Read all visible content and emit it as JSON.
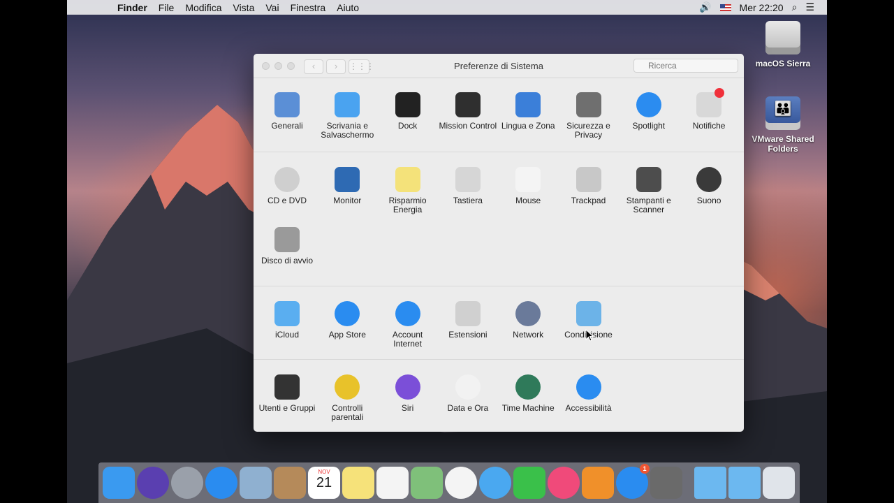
{
  "menubar": {
    "apple": "",
    "items": [
      "Finder",
      "File",
      "Modifica",
      "Vista",
      "Vai",
      "Finestra",
      "Aiuto"
    ],
    "clock": "Mer 22:20"
  },
  "desktop": {
    "icons": [
      {
        "label": "macOS Sierra"
      },
      {
        "label": "VMware Shared Folders"
      }
    ]
  },
  "window": {
    "title": "Preferenze di Sistema",
    "search_placeholder": "Ricerca",
    "sections": [
      [
        {
          "label": "Generali",
          "icon": "general-icon",
          "color": "#5b8fd6"
        },
        {
          "label": "Scrivania e Salvaschermo",
          "icon": "desktop-screensaver-icon",
          "color": "#4aa3f0"
        },
        {
          "label": "Dock",
          "icon": "dock-icon",
          "color": "#222222"
        },
        {
          "label": "Mission Control",
          "icon": "mission-control-icon",
          "color": "#2f2f2f"
        },
        {
          "label": "Lingua e Zona",
          "icon": "language-region-icon",
          "color": "#3b7fd9"
        },
        {
          "label": "Sicurezza e Privacy",
          "icon": "security-icon",
          "color": "#6f6f6f"
        },
        {
          "label": "Spotlight",
          "icon": "spotlight-icon",
          "color": "#2b8cf0"
        },
        {
          "label": "Notifiche",
          "icon": "notifications-icon",
          "color": "#d8d8d8"
        }
      ],
      [
        {
          "label": "CD e DVD",
          "icon": "cd-dvd-icon",
          "color": "#cfcfcf"
        },
        {
          "label": "Monitor",
          "icon": "monitor-icon",
          "color": "#2e6ab3"
        },
        {
          "label": "Risparmio Energia",
          "icon": "energy-icon",
          "color": "#f4e27a"
        },
        {
          "label": "Tastiera",
          "icon": "keyboard-icon",
          "color": "#d6d6d6"
        },
        {
          "label": "Mouse",
          "icon": "mouse-icon",
          "color": "#f4f4f4"
        },
        {
          "label": "Trackpad",
          "icon": "trackpad-icon",
          "color": "#c8c8c8"
        },
        {
          "label": "Stampanti e Scanner",
          "icon": "printer-icon",
          "color": "#4d4d4d"
        },
        {
          "label": "Suono",
          "icon": "sound-icon",
          "color": "#3a3a3a"
        },
        {
          "label": "Disco di avvio",
          "icon": "startup-disk-icon",
          "color": "#9a9a9a"
        }
      ],
      [
        {
          "label": "iCloud",
          "icon": "icloud-icon",
          "color": "#5aaef0"
        },
        {
          "label": "App Store",
          "icon": "app-store-icon",
          "color": "#2a8cf0"
        },
        {
          "label": "Account Internet",
          "icon": "internet-accounts-icon",
          "color": "#2a8cf0"
        },
        {
          "label": "Estensioni",
          "icon": "extensions-icon",
          "color": "#d0d0d0"
        },
        {
          "label": "Network",
          "icon": "network-icon",
          "color": "#6a7a9a"
        },
        {
          "label": "Condivisione",
          "icon": "sharing-icon",
          "color": "#6cb3e8"
        }
      ],
      [
        {
          "label": "Utenti e Gruppi",
          "icon": "users-groups-icon",
          "color": "#333333"
        },
        {
          "label": "Controlli parentali",
          "icon": "parental-controls-icon",
          "color": "#e8c22a"
        },
        {
          "label": "Siri",
          "icon": "siri-icon",
          "color": "#7b4fd8"
        },
        {
          "label": "Data e Ora",
          "icon": "date-time-icon",
          "color": "#f2f2f2"
        },
        {
          "label": "Time Machine",
          "icon": "time-machine-icon",
          "color": "#2f7a5a"
        },
        {
          "label": "Accessibilità",
          "icon": "accessibility-icon",
          "color": "#2a8cf0"
        }
      ]
    ]
  },
  "dock": {
    "items": [
      {
        "name": "finder",
        "color": "#3a9af0"
      },
      {
        "name": "siri",
        "color": "#5a3fb0"
      },
      {
        "name": "launchpad",
        "color": "#9aa0aa"
      },
      {
        "name": "safari",
        "color": "#2a8cf0"
      },
      {
        "name": "mail-stamp",
        "color": "#8fb0d0"
      },
      {
        "name": "contacts",
        "color": "#b58a5a"
      },
      {
        "name": "calendar",
        "color": "#ffffff",
        "text": "21",
        "month": "NOV"
      },
      {
        "name": "notes",
        "color": "#f6e27a"
      },
      {
        "name": "reminders",
        "color": "#f4f4f4"
      },
      {
        "name": "maps",
        "color": "#7fc07a"
      },
      {
        "name": "photos",
        "color": "#f4f4f4"
      },
      {
        "name": "messages",
        "color": "#4aa8f0"
      },
      {
        "name": "facetime",
        "color": "#3ac04a"
      },
      {
        "name": "itunes",
        "color": "#f04a7a"
      },
      {
        "name": "ibooks",
        "color": "#f0902a"
      },
      {
        "name": "app-store",
        "color": "#2a8cf0",
        "badge": "1"
      },
      {
        "name": "system-preferences",
        "color": "#6a6a6a"
      },
      {
        "name": "downloads-folder",
        "color": "#6cb8f0"
      },
      {
        "name": "applications-folder",
        "color": "#6cb8f0"
      },
      {
        "name": "trash",
        "color": "#e0e4ea"
      }
    ]
  }
}
